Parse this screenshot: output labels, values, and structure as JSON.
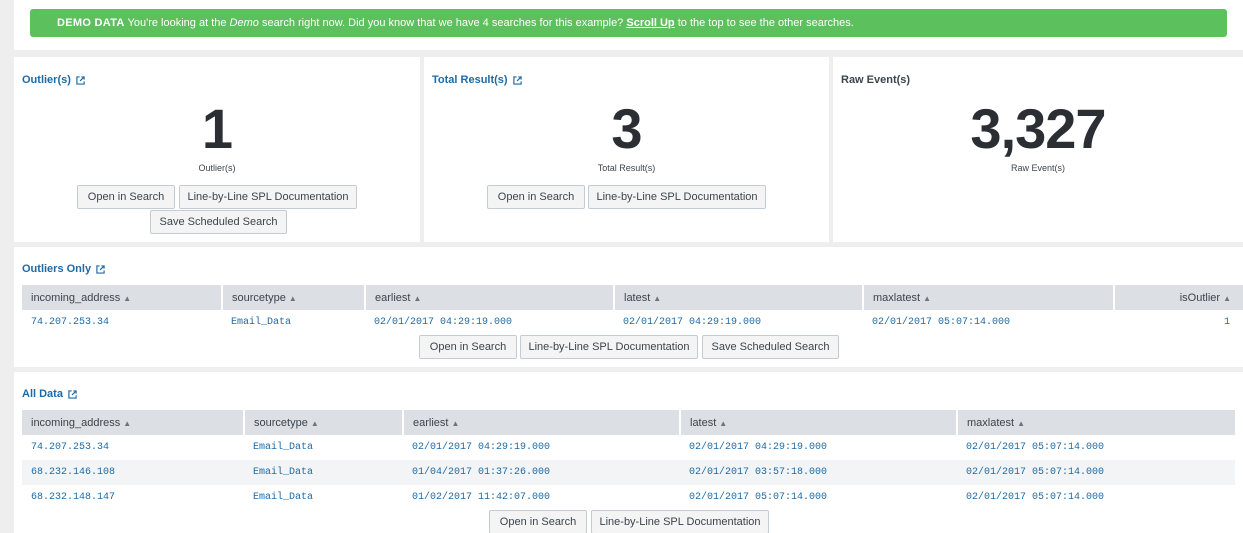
{
  "banner": {
    "tag": "DEMO DATA",
    "text_1": " You're looking at the ",
    "demo_word": "Demo",
    "text_2": " search right now. Did you know that we have 4 searches for this example? ",
    "link": "Scroll Up",
    "text_3": " to the top to see the other searches."
  },
  "panels": {
    "outliers": {
      "title": "Outlier(s)",
      "value": "1",
      "label": "Outlier(s)"
    },
    "total": {
      "title": "Total Result(s)",
      "value": "3",
      "label": "Total Result(s)"
    },
    "raw": {
      "title": "Raw Event(s)",
      "value": "3,327",
      "label": "Raw Event(s)"
    }
  },
  "buttons": {
    "open_in_search": "Open in Search",
    "spl_docs": "Line-by-Line SPL Documentation",
    "save_scheduled": "Save Scheduled Search"
  },
  "outliers_only": {
    "title": "Outliers Only",
    "columns": [
      "incoming_address",
      "sourcetype",
      "earliest",
      "latest",
      "maxlatest",
      "isOutlier"
    ],
    "rows": [
      [
        "74.207.253.34",
        "Email_Data",
        "02/01/2017 04:29:19.000",
        "02/01/2017 04:29:19.000",
        "02/01/2017 05:07:14.000",
        "1"
      ]
    ]
  },
  "all_data": {
    "title": "All Data",
    "columns": [
      "incoming_address",
      "sourcetype",
      "earliest",
      "latest",
      "maxlatest"
    ],
    "rows": [
      [
        "74.207.253.34",
        "Email_Data",
        "02/01/2017 04:29:19.000",
        "02/01/2017 04:29:19.000",
        "02/01/2017 05:07:14.000"
      ],
      [
        "68.232.146.108",
        "Email_Data",
        "01/04/2017 01:37:26.000",
        "02/01/2017 03:57:18.000",
        "02/01/2017 05:07:14.000"
      ],
      [
        "68.232.148.147",
        "Email_Data",
        "01/02/2017 11:42:07.000",
        "02/01/2017 05:07:14.000",
        "02/01/2017 05:07:14.000"
      ]
    ]
  },
  "icons": {
    "external": "external-link-icon",
    "sort": "sort-icon"
  },
  "colors": {
    "banner": "#5cc05c",
    "link": "#1e6aa5",
    "header_bg": "#dcdfe3"
  }
}
